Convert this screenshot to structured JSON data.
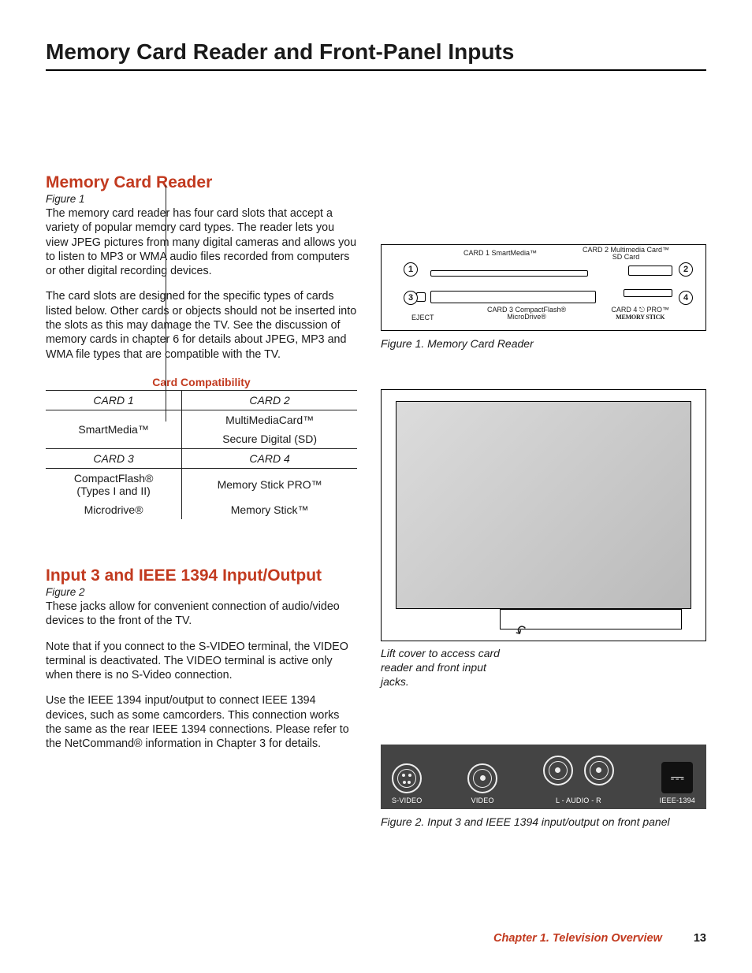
{
  "page": {
    "title": "Memory Card Reader and Front-Panel Inputs",
    "chapter": "Chapter 1. Television Overview",
    "number": "13"
  },
  "section1": {
    "heading": "Memory Card Reader",
    "fig": "Figure 1",
    "p1": "The memory card reader has four card slots that accept a variety of popular memory card types.  The reader lets you view JPEG pictures from many digital cameras and allows you to listen to MP3 or WMA audio files recorded from computers or other digital recording devices.",
    "p2": "The card slots are designed for the specific types of cards listed below.  Other cards or objects should not be inserted into the slots as this may damage the TV.  See the discussion of memory cards in chapter 6 for details about JPEG, MP3 and WMA file types that are compatible with the TV."
  },
  "compat": {
    "title": "Card Compatibility",
    "h_card1": "CARD 1",
    "h_card2": "CARD 2",
    "c1a": "SmartMedia™",
    "c2a": "MultiMediaCard™",
    "c2b": "Secure Digital (SD)",
    "h_card3": "CARD 3",
    "h_card4": "CARD 4",
    "c3a": "CompactFlash®\n(Types I and II)",
    "c4a": "Memory Stick PRO™",
    "c3b": "Microdrive®",
    "c4b": "Memory Stick™"
  },
  "section2": {
    "heading": "Input 3 and IEEE 1394 Input/Output",
    "fig": "Figure 2",
    "p1": "These jacks allow for convenient connection of audio/video devices to the front of the TV.",
    "p2": "Note that if you connect to the S-VIDEO terminal, the VIDEO terminal is deactivated.  The VIDEO terminal is active only when there is no S-Video connection.",
    "p3": "Use the IEEE 1394 input/output to connect IEEE 1394 devices, such as some camcorders.  This connection works the same as the rear IEEE 1394 connections.  Please refer to the NetCommand® information in Chapter 3 for details."
  },
  "reader_diagram": {
    "caption": "Figure 1.  Memory Card Reader",
    "n1": "1",
    "n2": "2",
    "n3": "3",
    "n4": "4",
    "eject": "EJECT",
    "lab1": "CARD 1 SmartMedia™",
    "lab2a": "CARD 2  Multimedia Card™",
    "lab2b": "SD Card",
    "lab3a": "CARD 3  CompactFlash®",
    "lab3b": "MicroDrive®",
    "lab4a": "CARD 4",
    "lab4b": "PRO™",
    "lab4c": "MEMORY STICK"
  },
  "tv": {
    "lift": "Lift cover to access card reader and front input jacks."
  },
  "jacks": {
    "svideo": "S-VIDEO",
    "video": "VIDEO",
    "audio": "L   -   AUDIO   -   R",
    "ieee": "IEEE-1394",
    "caption": "Figure 2.  Input 3 and IEEE 1394 input/output on front panel"
  }
}
